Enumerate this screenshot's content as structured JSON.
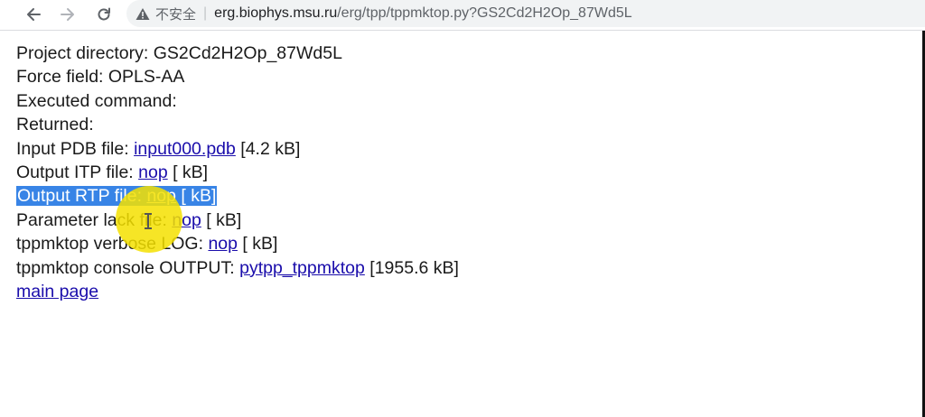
{
  "browser": {
    "security_label": "不安全",
    "separator": "|",
    "url_host": "erg.biophys.msu.ru",
    "url_path": "/erg/tpp/tppmktop.py?GS2Cd2H2Op_87Wd5L"
  },
  "page": {
    "project_label": "Project directory: ",
    "project_value": "GS2Cd2H2Op_87Wd5L",
    "forcefield_label": "Force field: ",
    "forcefield_value": "OPLS-AA",
    "executed_label": "Executed command:",
    "returned_label": "Returned:",
    "input_pdb_label": "Input PDB file: ",
    "input_pdb_link": "input000.pdb",
    "input_pdb_size": " [4.2 kB]",
    "output_itp_label": "Output ITP file: ",
    "output_itp_link": "nop",
    "output_itp_size": " [ kB]",
    "output_rtp_label": "Output RTP file: ",
    "output_rtp_link": "nop",
    "output_rtp_size": " [ kB]",
    "param_lack_label": "Parameter lack file: ",
    "param_lack_link": "nop",
    "param_lack_size": " [ kB]",
    "verbose_log_label": "tppmktop verbose LOG: ",
    "verbose_log_link": "nop",
    "verbose_log_size": " [ kB]",
    "console_output_label": "tppmktop console OUTPUT: ",
    "console_output_link": "pytpp_tppmktop",
    "console_output_size": " [1955.6 kB]",
    "main_page_link": "main page"
  },
  "icons": {
    "back": "arrow-left-icon",
    "forward": "arrow-right-icon",
    "reload": "reload-icon",
    "warning": "warning-triangle-icon"
  },
  "colors": {
    "link": "#1a0dab",
    "selection": "#3884e6",
    "cursor_halo": "#f4e000"
  }
}
